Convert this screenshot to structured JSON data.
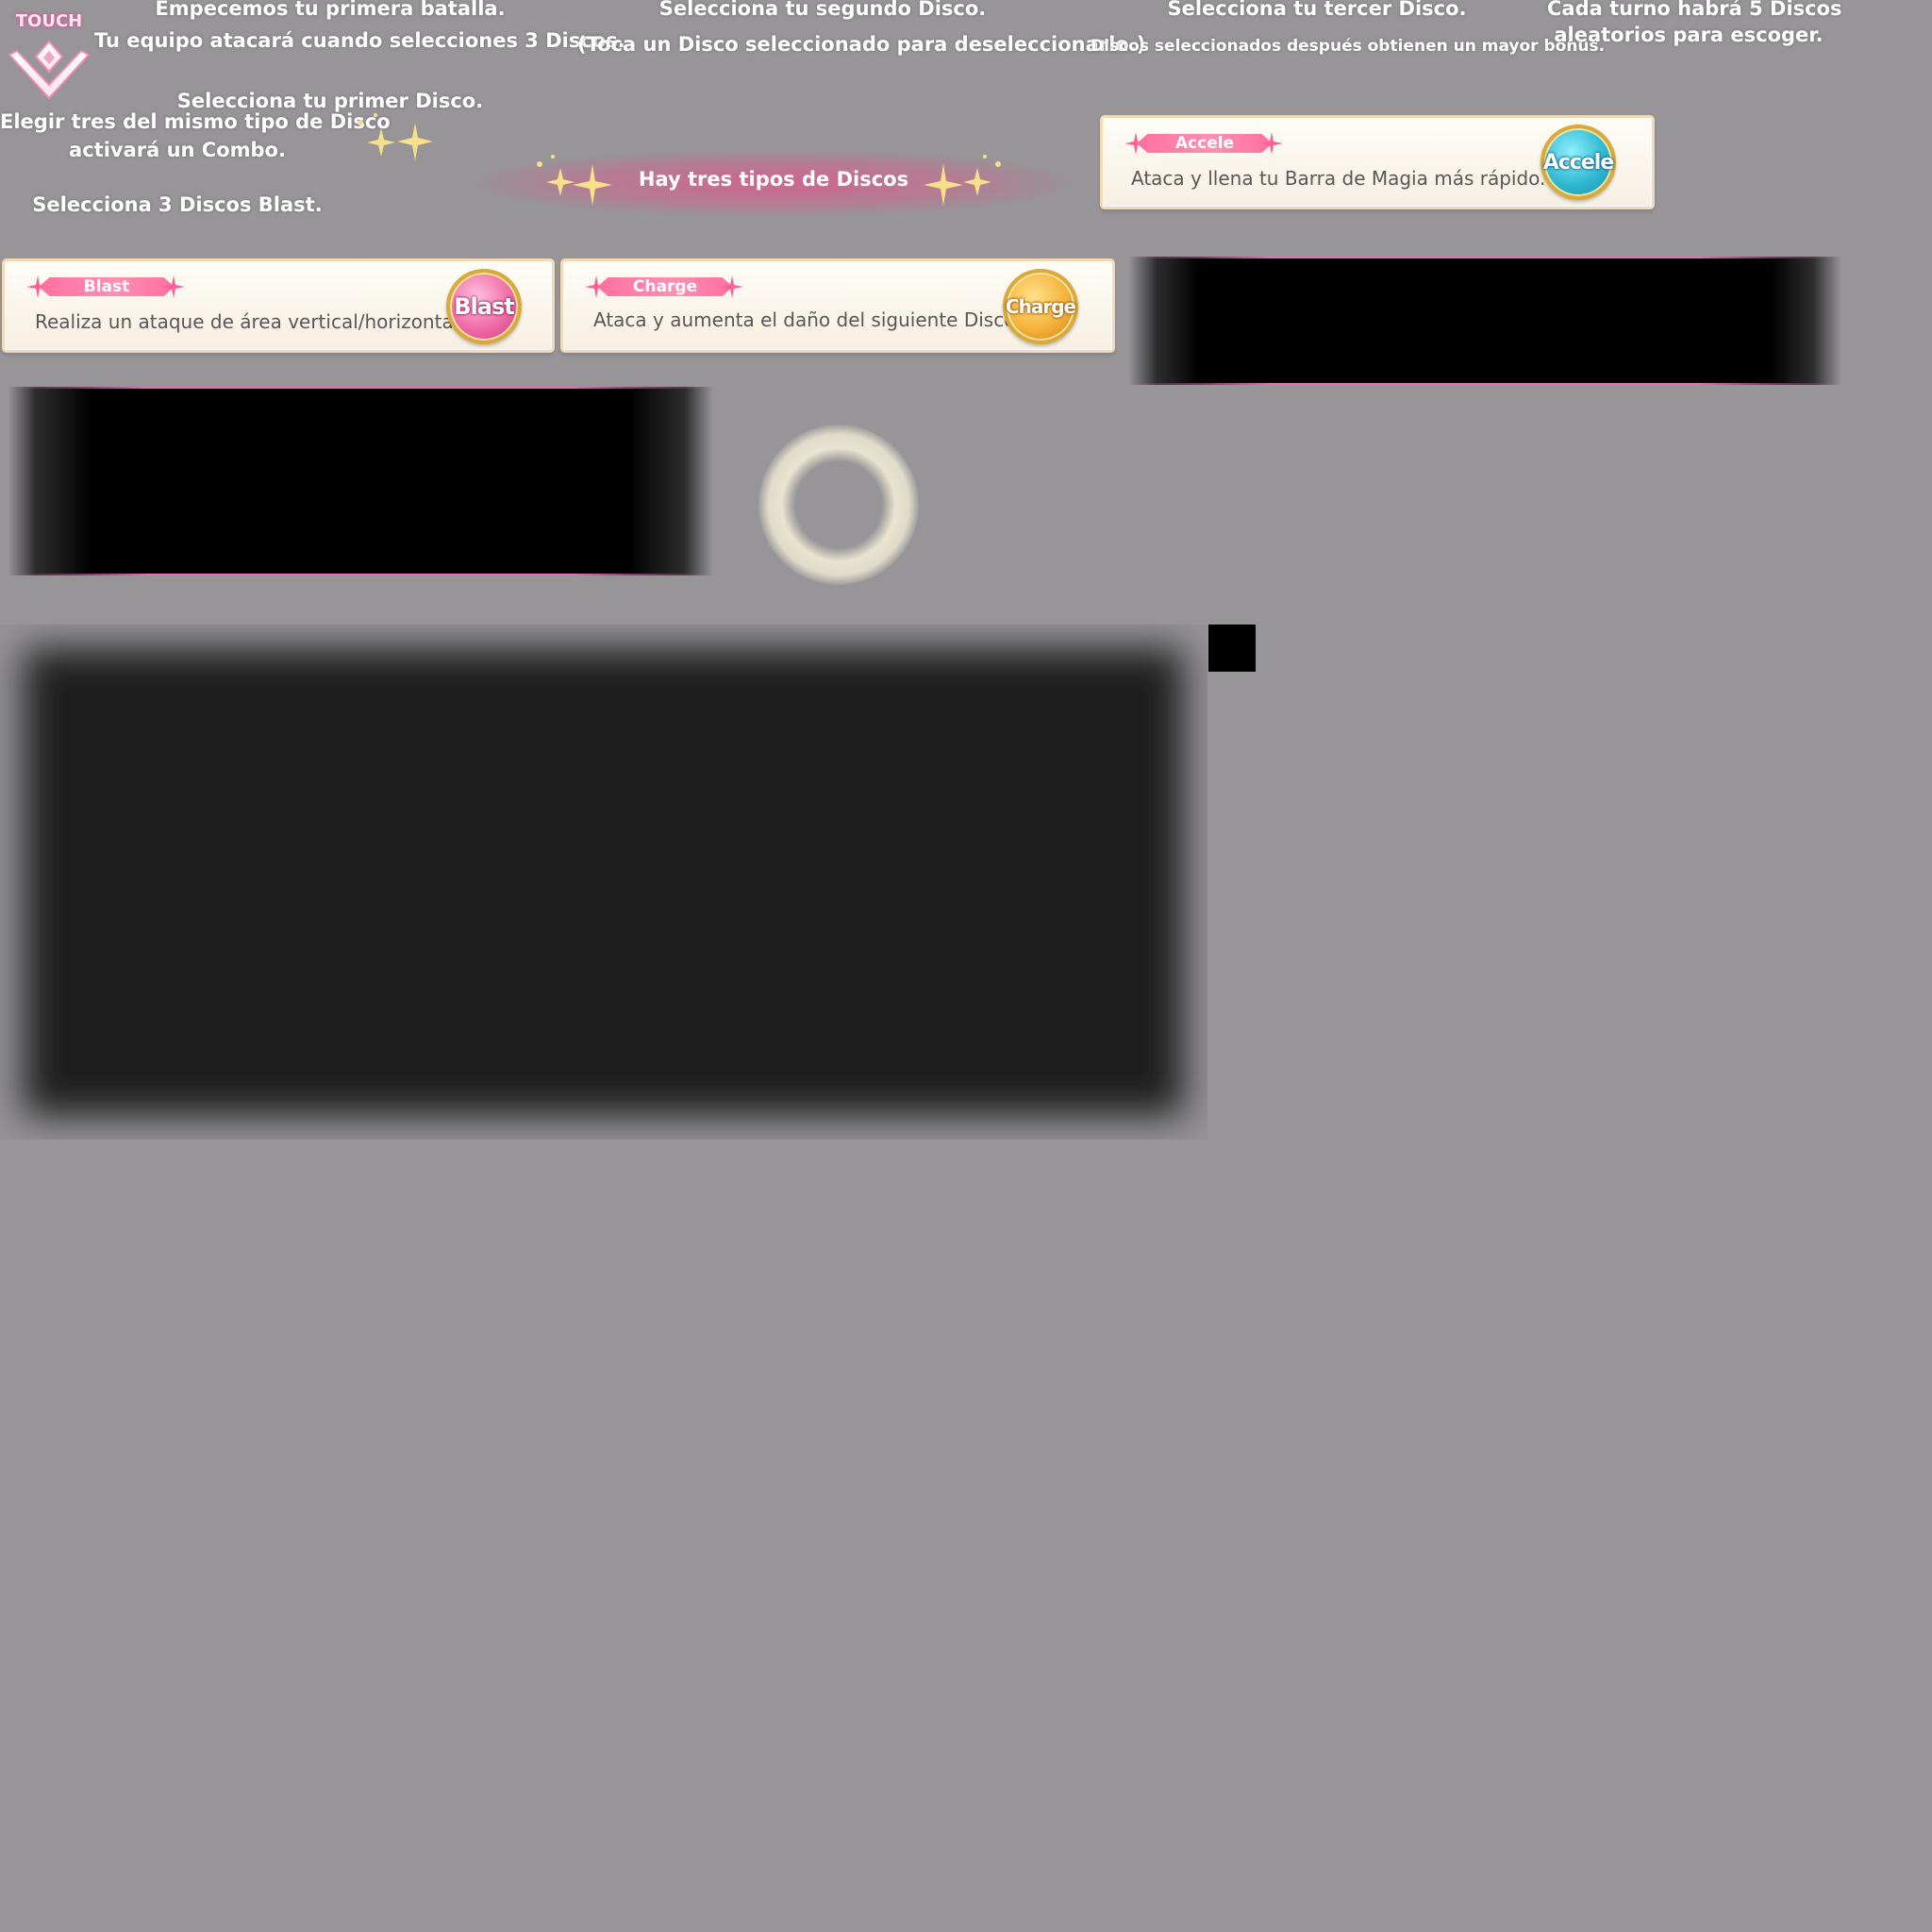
{
  "tutorial_texts": {
    "lets_start": "Empecemos tu primera batalla.",
    "team_attacks": "Tu equipo atacará cuando selecciones 3 Discos.",
    "select_first": "Selecciona tu primer Disco.",
    "combo_line1": "Elegir tres del mismo tipo de Disco",
    "combo_line2": "activará un Combo.",
    "select_three_blast": "Selecciona 3 Discos Blast.",
    "select_second": "Selecciona tu segundo Disco.",
    "deselect_hint": "(Toca un Disco seleccionado para deseleccionarlo.)",
    "select_third": "Selecciona tu tercer Disco.",
    "later_bonus": "Discos seleccionados después obtienen un mayor bonus.",
    "five_discs_line1": "Cada turno habrá 5 Discos",
    "five_discs_line2": "aleatorios para escoger."
  },
  "touch_label": "TOUCH",
  "banner_text": "Hay tres tipos de Discos",
  "cards": {
    "accele": {
      "tag": "Accele",
      "desc": "Ataca y llena tu Barra de Magia más rápido.",
      "disc": "Accele",
      "color": "#2fb8d0"
    },
    "blast": {
      "tag": "Blast",
      "desc": "Realiza un ataque de área vertical/horizontal.",
      "disc": "Blast",
      "color": "#e8488e"
    },
    "charge": {
      "tag": "Charge",
      "desc": "Ataca y aumenta el daño del siguiente Disco.",
      "disc": "Charge",
      "color": "#f09a20"
    }
  },
  "colors": {
    "background": "#979598",
    "tag_pink": "#ff6fa0",
    "card_border": "#f3d9b6",
    "sparkle": "#f7e08a"
  }
}
